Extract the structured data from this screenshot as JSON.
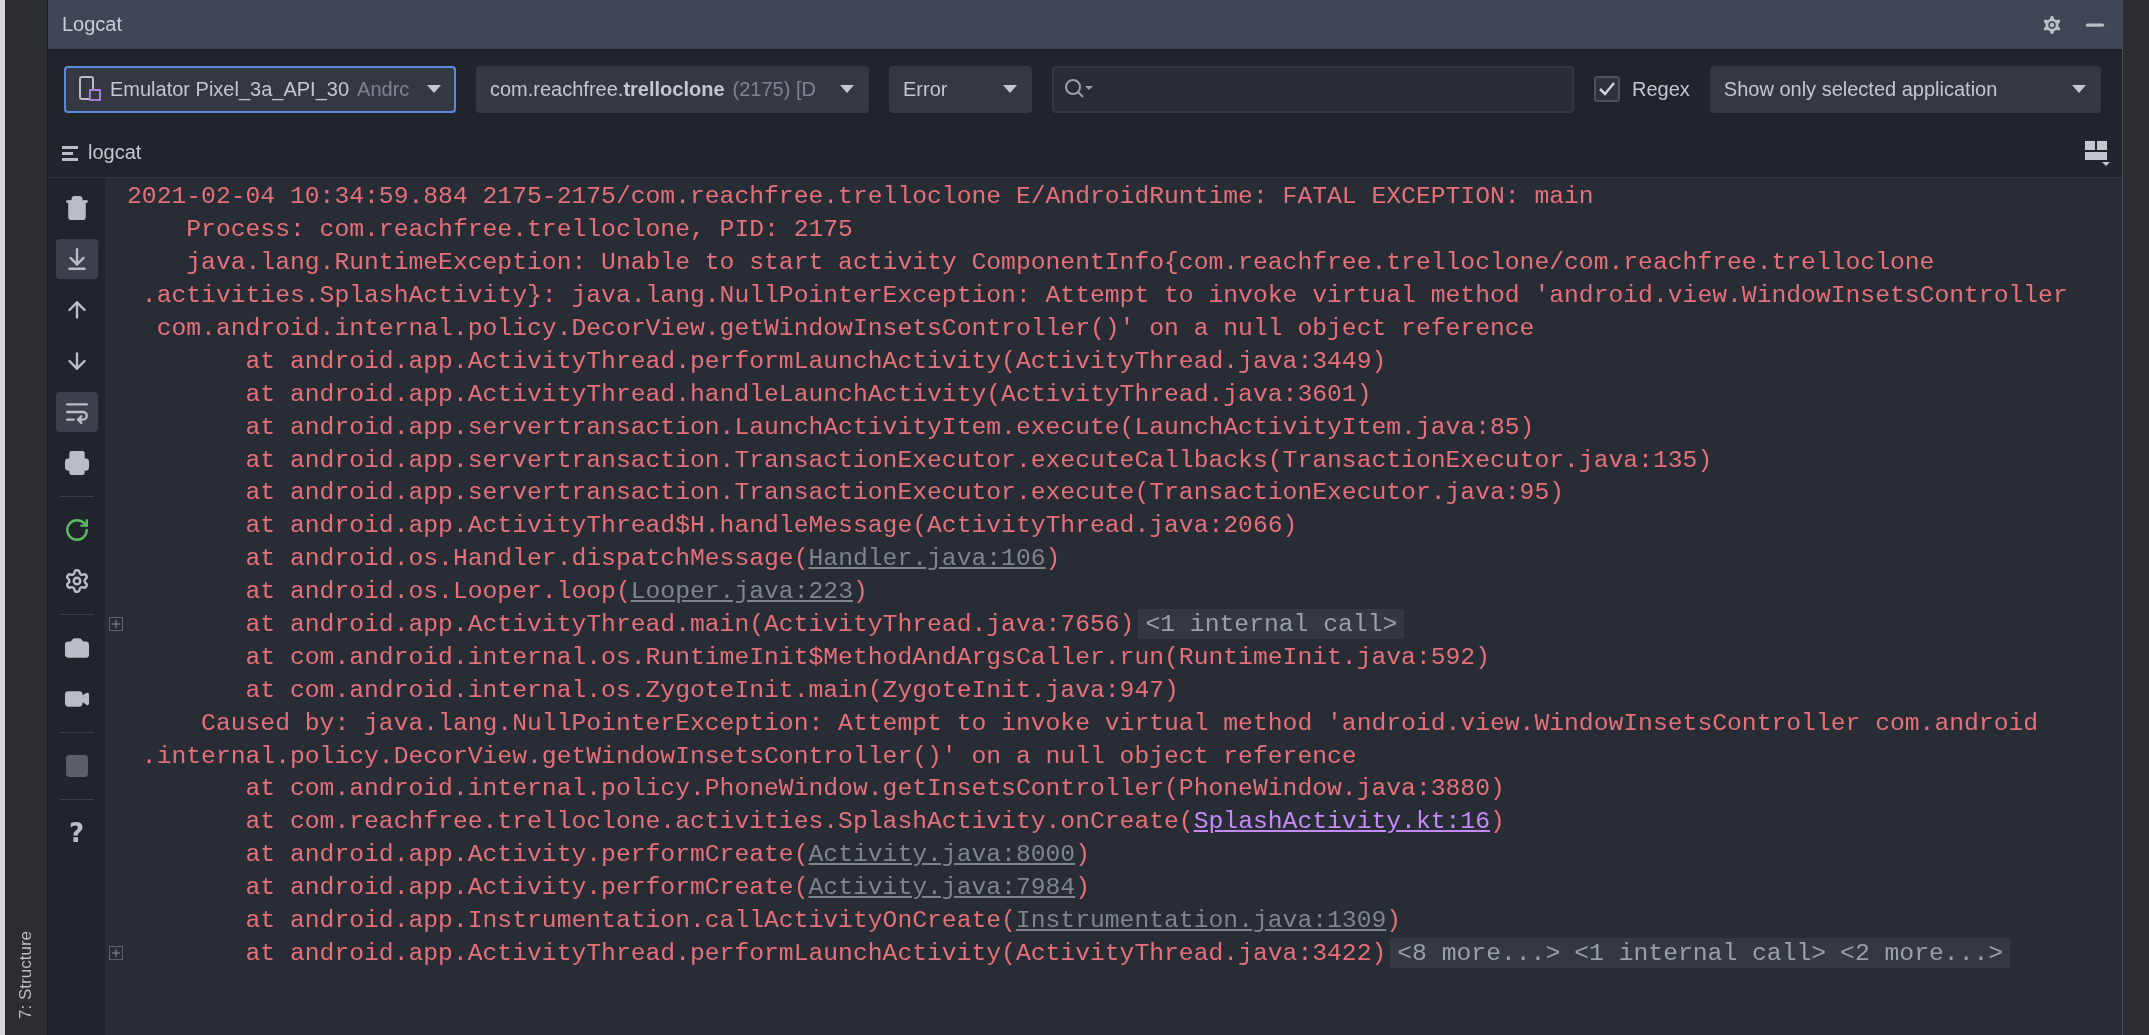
{
  "header": {
    "title": "Logcat"
  },
  "toolbar": {
    "device": {
      "name": "Emulator Pixel_3a_API_30",
      "detail": "Andrc",
      "focused": true
    },
    "process": {
      "name": "com.reachfree.**trelloclone**",
      "detail": "(2175) [D"
    },
    "level": {
      "value": "Error"
    },
    "regex": {
      "label": "Regex",
      "checked": true
    },
    "filter": {
      "value": "Show only selected application"
    }
  },
  "tab": {
    "label": "logcat"
  },
  "side_tools": [
    {
      "kind": "trash",
      "selected": false
    },
    {
      "kind": "scroll-end",
      "selected": true
    },
    {
      "kind": "up",
      "selected": false
    },
    {
      "kind": "down",
      "selected": false
    },
    {
      "kind": "wrap",
      "selected": true
    },
    {
      "kind": "print",
      "selected": false
    },
    {
      "kind": "divider"
    },
    {
      "kind": "restart",
      "selected": false
    },
    {
      "kind": "settings",
      "selected": false
    },
    {
      "kind": "divider"
    },
    {
      "kind": "camera",
      "selected": false
    },
    {
      "kind": "video",
      "selected": false
    },
    {
      "kind": "divider"
    },
    {
      "kind": "stop",
      "selected": false,
      "disabled": true
    },
    {
      "kind": "divider"
    },
    {
      "kind": "help",
      "selected": false,
      "label": "?"
    }
  ],
  "lines": [
    {
      "fold_marker": false,
      "segments": [
        {
          "kind": "text",
          "text": "2021-02-04 10:34:59.884 2175-2175/com.reachfree.trelloclone E/AndroidRuntime: FATAL EXCEPTION: main"
        }
      ]
    },
    {
      "fold_marker": false,
      "segments": [
        {
          "kind": "text",
          "text": "    Process: com.reachfree.trelloclone, PID: 2175"
        }
      ]
    },
    {
      "fold_marker": false,
      "segments": [
        {
          "kind": "text",
          "text": "    java.lang.RuntimeException: Unable to start activity ComponentInfo{com.reachfree.trelloclone/com.reachfree.trelloclone"
        }
      ]
    },
    {
      "fold_marker": false,
      "segments": [
        {
          "kind": "text",
          "text": " .activities.SplashActivity}: java.lang.NullPointerException: Attempt to invoke virtual method 'android.view.WindowInsetsController"
        }
      ]
    },
    {
      "fold_marker": false,
      "segments": [
        {
          "kind": "text",
          "text": "  com.android.internal.policy.DecorView.getWindowInsetsController()' on a null object reference"
        }
      ]
    },
    {
      "fold_marker": false,
      "segments": [
        {
          "kind": "text",
          "text": "        at android.app.ActivityThread.performLaunchActivity(ActivityThread.java:3449)"
        }
      ]
    },
    {
      "fold_marker": false,
      "segments": [
        {
          "kind": "text",
          "text": "        at android.app.ActivityThread.handleLaunchActivity(ActivityThread.java:3601)"
        }
      ]
    },
    {
      "fold_marker": false,
      "segments": [
        {
          "kind": "text",
          "text": "        at android.app.servertransaction.LaunchActivityItem.execute(LaunchActivityItem.java:85)"
        }
      ]
    },
    {
      "fold_marker": false,
      "segments": [
        {
          "kind": "text",
          "text": "        at android.app.servertransaction.TransactionExecutor.executeCallbacks(TransactionExecutor.java:135)"
        }
      ]
    },
    {
      "fold_marker": false,
      "segments": [
        {
          "kind": "text",
          "text": "        at android.app.servertransaction.TransactionExecutor.execute(TransactionExecutor.java:95)"
        }
      ]
    },
    {
      "fold_marker": false,
      "segments": [
        {
          "kind": "text",
          "text": "        at android.app.ActivityThread$H.handleMessage(ActivityThread.java:2066)"
        }
      ]
    },
    {
      "fold_marker": false,
      "segments": [
        {
          "kind": "text",
          "text": "        at android.os.Handler.dispatchMessage("
        },
        {
          "kind": "library",
          "text": "Handler.java:106"
        },
        {
          "kind": "text",
          "text": ")"
        }
      ]
    },
    {
      "fold_marker": false,
      "segments": [
        {
          "kind": "text",
          "text": "        at android.os.Looper.loop("
        },
        {
          "kind": "library",
          "text": "Looper.java:223"
        },
        {
          "kind": "text",
          "text": ")"
        }
      ]
    },
    {
      "fold_marker": true,
      "segments": [
        {
          "kind": "text",
          "text": "        at android.app.ActivityThread.main(ActivityThread.java:7656)"
        }
      ],
      "chips": [
        "<1 internal call>"
      ]
    },
    {
      "fold_marker": false,
      "segments": [
        {
          "kind": "text",
          "text": "        at com.android.internal.os.RuntimeInit$MethodAndArgsCaller.run(RuntimeInit.java:592)"
        }
      ]
    },
    {
      "fold_marker": false,
      "segments": [
        {
          "kind": "text",
          "text": "        at com.android.internal.os.ZygoteInit.main(ZygoteInit.java:947)"
        }
      ]
    },
    {
      "fold_marker": false,
      "segments": [
        {
          "kind": "text",
          "text": "     Caused by: java.lang.NullPointerException: Attempt to invoke virtual method 'android.view.WindowInsetsController com.android"
        }
      ]
    },
    {
      "fold_marker": false,
      "segments": [
        {
          "kind": "text",
          "text": " .internal.policy.DecorView.getWindowInsetsController()' on a null object reference"
        }
      ]
    },
    {
      "fold_marker": false,
      "segments": [
        {
          "kind": "text",
          "text": "        at com.android.internal.policy.PhoneWindow.getInsetsController(PhoneWindow.java:3880)"
        }
      ]
    },
    {
      "fold_marker": false,
      "segments": [
        {
          "kind": "text",
          "text": "        at com.reachfree.trelloclone.activities.SplashActivity.onCreate("
        },
        {
          "kind": "source",
          "text": "SplashActivity.kt:16"
        },
        {
          "kind": "text",
          "text": ")"
        }
      ]
    },
    {
      "fold_marker": false,
      "segments": [
        {
          "kind": "text",
          "text": "        at android.app.Activity.performCreate("
        },
        {
          "kind": "library",
          "text": "Activity.java:8000"
        },
        {
          "kind": "text",
          "text": ")"
        }
      ]
    },
    {
      "fold_marker": false,
      "segments": [
        {
          "kind": "text",
          "text": "        at android.app.Activity.performCreate("
        },
        {
          "kind": "library",
          "text": "Activity.java:7984"
        },
        {
          "kind": "text",
          "text": ")"
        }
      ]
    },
    {
      "fold_marker": false,
      "segments": [
        {
          "kind": "text",
          "text": "        at android.app.Instrumentation.callActivityOnCreate("
        },
        {
          "kind": "library",
          "text": "Instrumentation.java:1309"
        },
        {
          "kind": "text",
          "text": ")"
        }
      ]
    },
    {
      "fold_marker": true,
      "segments": [
        {
          "kind": "text",
          "text": "        at android.app.ActivityThread.performLaunchActivity(ActivityThread.java:3422)"
        }
      ],
      "chips": [
        "<8 more...>",
        "<1 internal call>",
        "<2 more...>"
      ]
    }
  ],
  "structure_tab": {
    "label": "7: Structure"
  }
}
